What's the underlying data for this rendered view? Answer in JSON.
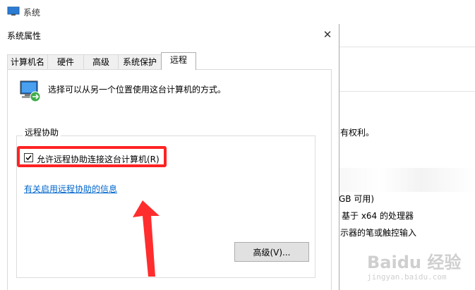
{
  "background_window": {
    "title": "系统",
    "texts": {
      "rights_tail": "有权利。",
      "memory_tail": "GB 可用)",
      "processor_tail": "基于 x64 的处理器",
      "pen_tail": "示器的笔或触控输入"
    }
  },
  "dialog": {
    "title": "系统属性",
    "close_glyph": "✕",
    "tabs": [
      {
        "label": "计算机名",
        "active": false
      },
      {
        "label": "硬件",
        "active": false
      },
      {
        "label": "高级",
        "active": false
      },
      {
        "label": "系统保护",
        "active": false
      },
      {
        "label": "远程",
        "active": true
      }
    ],
    "description": "选择可以从另一个位置使用这台计算机的方式。",
    "remote_assistance": {
      "group_label": "远程协助",
      "checkbox_label": "允许远程协助连接这台计算机(R)",
      "checked": true,
      "info_link": "有关启用远程协助的信息",
      "advanced_button": "高级(V)..."
    }
  },
  "annotation": {
    "highlight_color": "#ff2323",
    "arrow_color": "#ff2d2d"
  },
  "watermark": {
    "logo_text": "Baidu 经验",
    "url": "jingyan.baidu.com"
  },
  "colors": {
    "link": "#0066cc",
    "button_bg": "#e1e1e1"
  }
}
